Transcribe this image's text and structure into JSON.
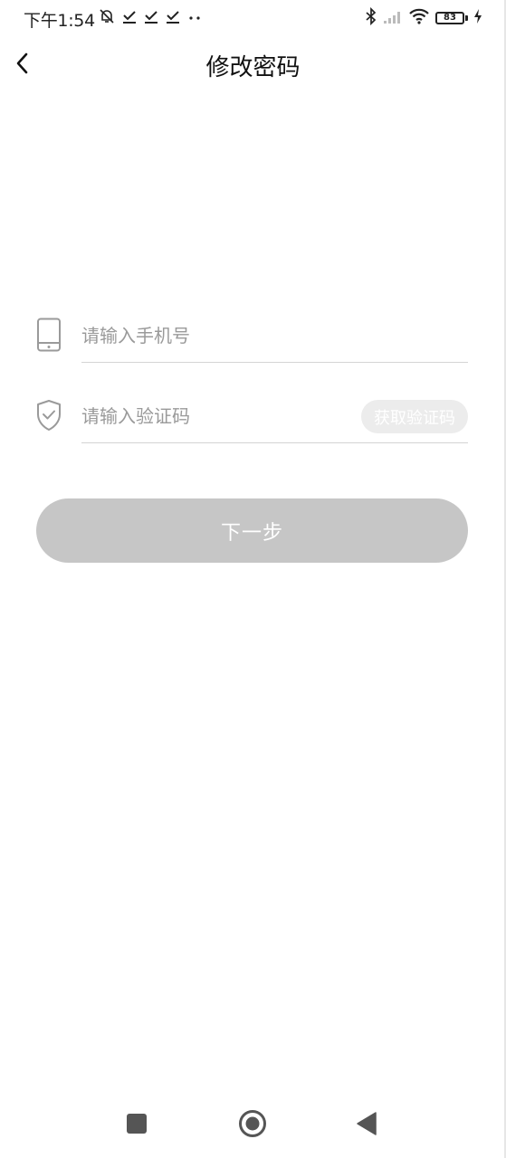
{
  "status_bar": {
    "time": "下午1:54",
    "battery_level": "83",
    "battery_color": "#7bd34a",
    "left_icons": [
      "bell-off-icon",
      "download-done-icon",
      "download-done-icon",
      "download-done-icon",
      "more-dots-icon"
    ],
    "right_icons": [
      "bluetooth-icon",
      "signal-icon",
      "wifi-icon",
      "battery-icon",
      "charging-icon"
    ]
  },
  "nav": {
    "title": "修改密码",
    "back_icon": "chevron-left-icon"
  },
  "form": {
    "phone": {
      "icon": "phone-icon",
      "placeholder": "请输入手机号",
      "value": ""
    },
    "code": {
      "icon": "shield-check-icon",
      "placeholder": "请输入验证码",
      "value": "",
      "get_code_label": "获取验证码"
    },
    "next_label": "下一步"
  },
  "system_nav": {
    "recents_icon": "square-icon",
    "home_icon": "circle-home-icon",
    "back_icon": "triangle-back-icon"
  },
  "colors": {
    "button_disabled": "#c6c6c6",
    "get_code_bg": "#ececec",
    "placeholder": "#9a9a9a",
    "divider": "#d4d4d4"
  }
}
